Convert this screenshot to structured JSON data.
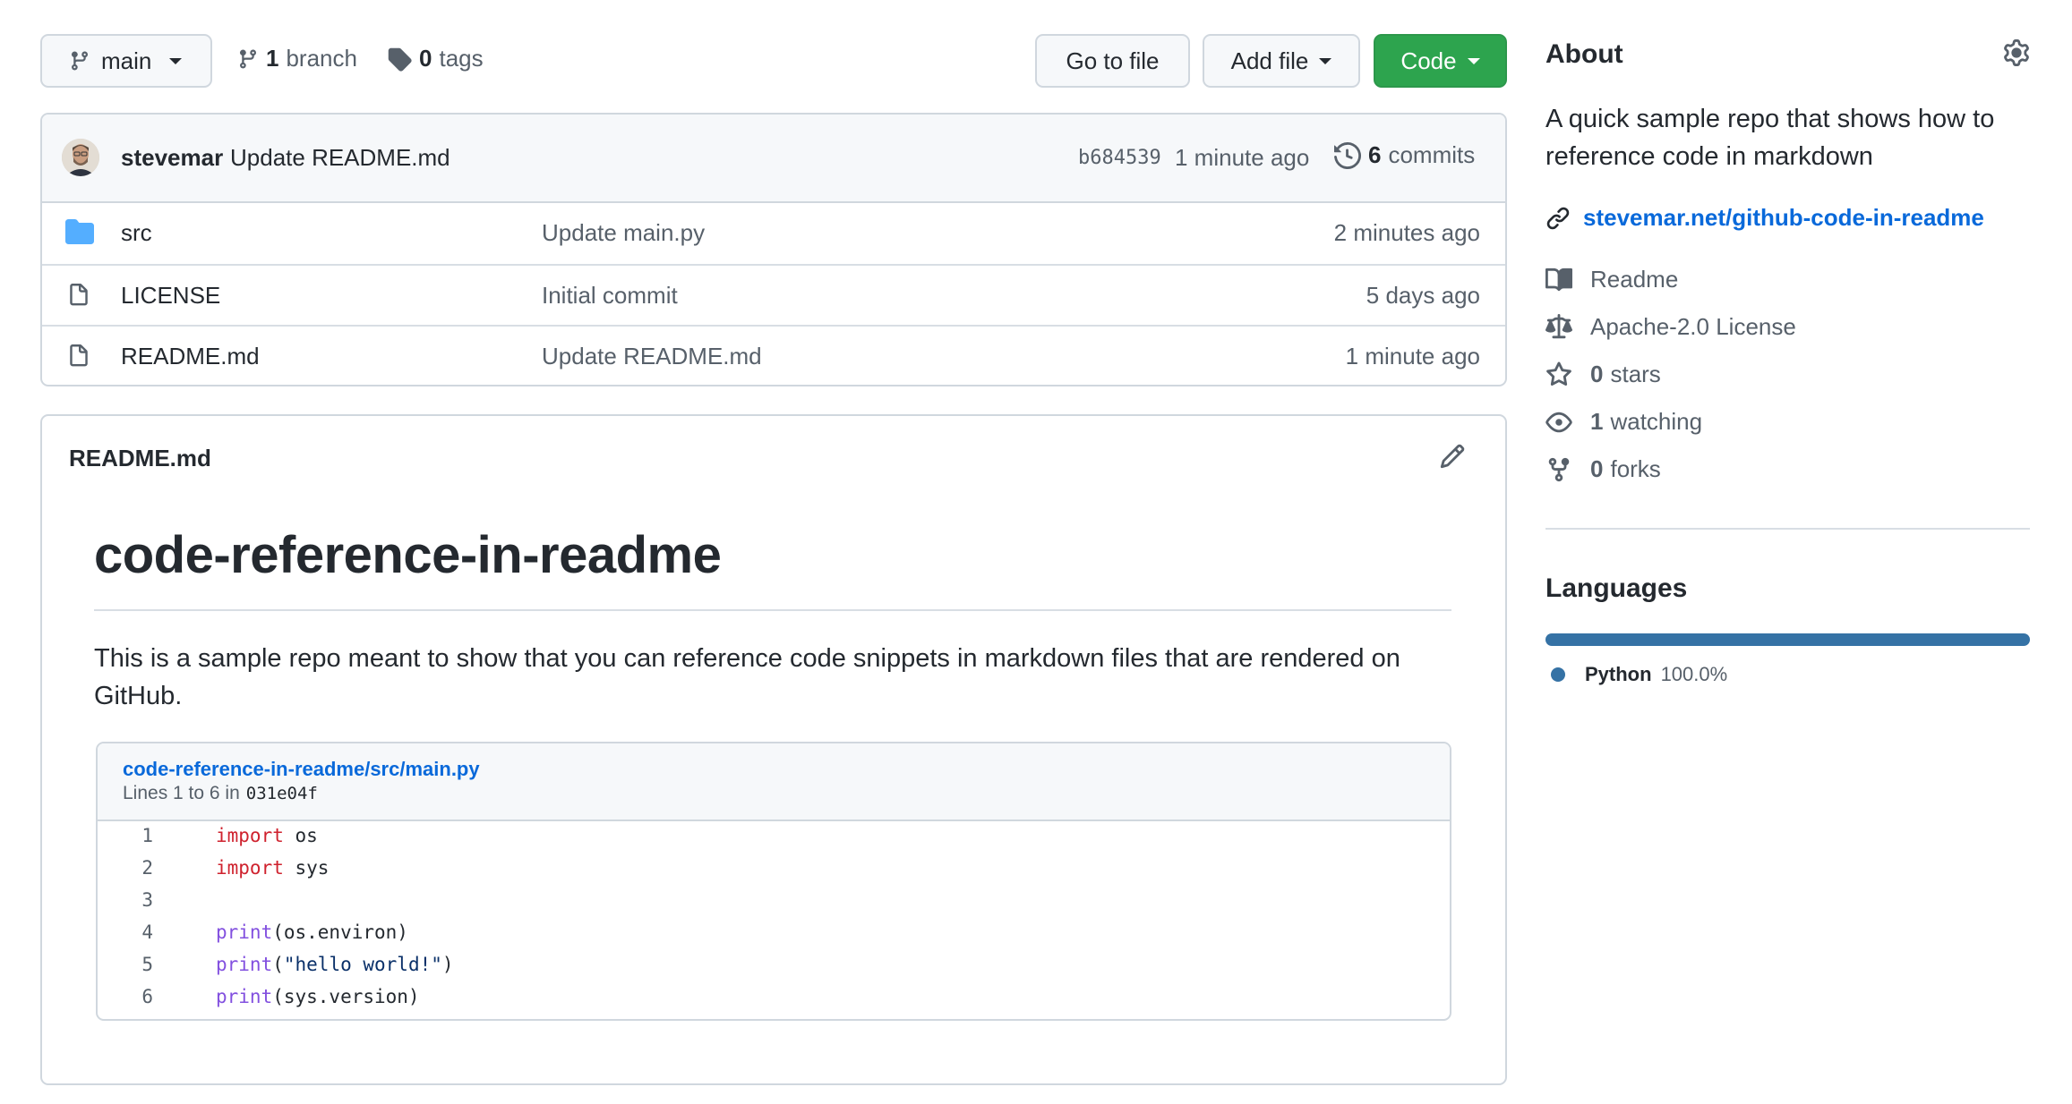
{
  "topbar": {
    "branch_button_label": "main",
    "branch_count": "1",
    "branch_word": "branch",
    "tag_count": "0",
    "tag_word": "tags",
    "go_to_file_label": "Go to file",
    "add_file_label": "Add file",
    "code_label": "Code"
  },
  "commit": {
    "author": "stevemar",
    "message": "Update README.md",
    "sha": "b684539",
    "time": "1 minute ago",
    "commit_count": "6",
    "commit_word": "commits"
  },
  "files": [
    {
      "name": "src",
      "type": "folder",
      "message": "Update main.py",
      "age": "2 minutes ago"
    },
    {
      "name": "LICENSE",
      "type": "file",
      "message": "Initial commit",
      "age": "5 days ago"
    },
    {
      "name": "README.md",
      "type": "file",
      "message": "Update README.md",
      "age": "1 minute ago"
    }
  ],
  "readme": {
    "filename": "README.md",
    "heading": "code-reference-in-readme",
    "paragraph_line1": "This is a sample repo meant to show that you can reference code snippets in markdown files that are rendered on",
    "paragraph_line2": "GitHub.",
    "embed_path": "code-reference-in-readme/src/main.py",
    "embed_lines_text": "Lines 1 to 6 in",
    "embed_sha": "031e04f",
    "code": [
      {
        "n": "1",
        "kw": "import",
        "rest": " os"
      },
      {
        "n": "2",
        "kw": "import",
        "rest": " sys"
      },
      {
        "n": "3",
        "kw": "",
        "rest": ""
      },
      {
        "n": "4",
        "fn": "print",
        "rest": "(os.environ)"
      },
      {
        "n": "5",
        "fn": "print",
        "open": "(",
        "str": "\"hello world!\"",
        "close": ")"
      },
      {
        "n": "6",
        "fn": "print",
        "rest": "(sys.version)"
      }
    ]
  },
  "about": {
    "title": "About",
    "description_line1": "A quick sample repo that shows how to",
    "description_line2": "reference code in markdown",
    "link": "stevemar.net/github-code-in-readme",
    "readme": "Readme",
    "license": "Apache-2.0 License",
    "stars_count": "0",
    "stars_word": "stars",
    "watching_count": "1",
    "watching_word": "watching",
    "forks_count": "0",
    "forks_word": "forks"
  },
  "languages": {
    "title": "Languages",
    "items": [
      {
        "name": "Python",
        "percent": "100.0%",
        "color": "#3572A5",
        "fraction": 1.0
      }
    ]
  },
  "colors": {
    "accent": "#0969da",
    "green": "#2da44e",
    "border": "#d0d7de",
    "folder": "#54aeff"
  }
}
